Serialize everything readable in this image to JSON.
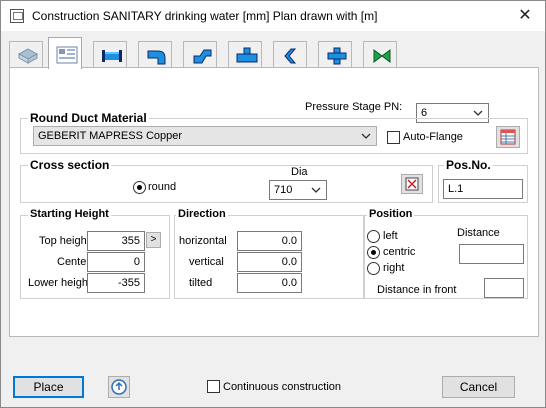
{
  "window": {
    "title": "Construction SANITARY drinking water [mm]    Plan drawn with  [m]",
    "close_glyph": "✕"
  },
  "tabs": [
    {
      "icon": "insulation-icon"
    },
    {
      "icon": "properties-icon",
      "active": true
    },
    {
      "icon": "straight-pipe-icon"
    },
    {
      "icon": "bend-icon"
    },
    {
      "icon": "offset-icon"
    },
    {
      "icon": "tee-branch-icon"
    },
    {
      "icon": "reducer-icon"
    },
    {
      "icon": "cross-fitting-icon"
    },
    {
      "icon": "valve-icon"
    }
  ],
  "pressure": {
    "label": "Pressure Stage PN:",
    "value": "6"
  },
  "material": {
    "title": "Round Duct Material",
    "value": "GEBERIT MAPRESS Copper",
    "auto_flange_label": "Auto-Flange",
    "auto_flange_checked": false
  },
  "cross_section": {
    "title": "Cross section",
    "shape_label": "round",
    "dia_label": "Dia",
    "dia_value": "710"
  },
  "pos_no": {
    "title": "Pos.No.",
    "value": "L.1"
  },
  "starting_height": {
    "title": "Starting Height",
    "top_label": "Top height",
    "top_value": "355",
    "arrow": ">",
    "center_label": "Center",
    "center_value": "0",
    "lower_label": "Lower height",
    "lower_value": "-355"
  },
  "direction": {
    "title": "Direction",
    "horizontal_label": "horizontal",
    "horizontal_value": "0.0",
    "vertical_label": "vertical",
    "vertical_value": "0.0",
    "tilted_label": "tilted",
    "tilted_value": "0.0"
  },
  "position": {
    "title": "Position",
    "left_label": "left",
    "centric_label": "centric",
    "right_label": "right",
    "selected": "centric",
    "distance_label": "Distance",
    "distance_value": "",
    "distance_front_label": "Distance in front",
    "distance_front_value": ""
  },
  "footer": {
    "place_label": "Place",
    "continuous_label": "Continuous construction",
    "continuous_checked": false,
    "cancel_label": "Cancel"
  }
}
